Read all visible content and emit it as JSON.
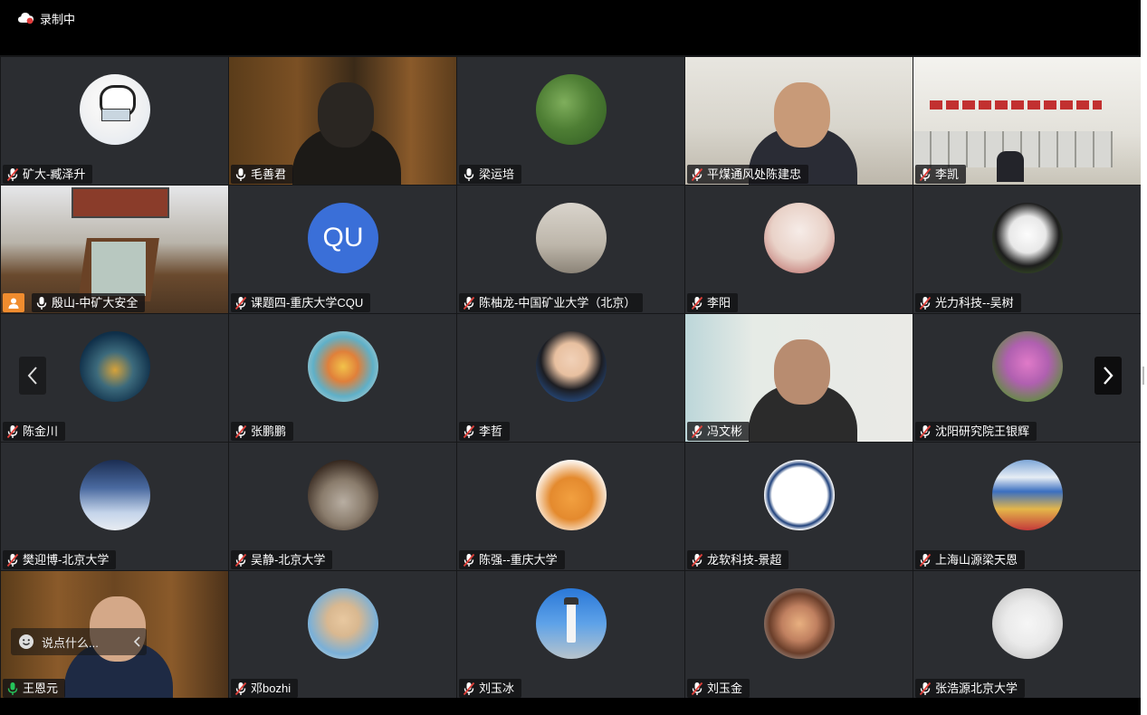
{
  "recording": {
    "label": "录制中"
  },
  "participants": [
    {
      "name": "矿大-臧泽升",
      "mic": "muted"
    },
    {
      "name": "毛善君",
      "mic": "on"
    },
    {
      "name": "梁运培",
      "mic": "on"
    },
    {
      "name": "平煤通风处陈建忠",
      "mic": "muted"
    },
    {
      "name": "李凯",
      "mic": "muted"
    },
    {
      "name": "殷山-中矿大安全",
      "mic": "on"
    },
    {
      "name": "课题四-重庆大学CQU",
      "mic": "muted",
      "avatar_text": "QU"
    },
    {
      "name": "陈柚龙-中国矿业大学（北京）",
      "mic": "muted"
    },
    {
      "name": "李阳",
      "mic": "muted"
    },
    {
      "name": "光力科技--吴树",
      "mic": "muted"
    },
    {
      "name": "陈金川",
      "mic": "muted"
    },
    {
      "name": "张鹏鹏",
      "mic": "muted"
    },
    {
      "name": "李哲",
      "mic": "muted"
    },
    {
      "name": "冯文彬",
      "mic": "muted"
    },
    {
      "name": "沈阳研究院王银辉",
      "mic": "muted"
    },
    {
      "name": "樊迎博-北京大学",
      "mic": "muted"
    },
    {
      "name": "吴静-北京大学",
      "mic": "muted"
    },
    {
      "name": "陈强--重庆大学",
      "mic": "muted"
    },
    {
      "name": "龙软科技-景超",
      "mic": "muted"
    },
    {
      "name": "上海山源梁天恩",
      "mic": "muted"
    },
    {
      "name": "王恩元",
      "mic": "speaking"
    },
    {
      "name": "邓bozhi",
      "mic": "muted"
    },
    {
      "name": "刘玉冰",
      "mic": "muted"
    },
    {
      "name": "刘玉金",
      "mic": "muted"
    },
    {
      "name": "张浩源北京大学",
      "mic": "muted"
    }
  ],
  "chat": {
    "placeholder": "说点什么..."
  },
  "colors": {
    "speaking_border": "#25c45a",
    "tile_bg": "#2b2d31",
    "muted_mic": "#e0403a"
  },
  "icons": {
    "prev": "chevron-left-icon",
    "next": "chevron-right-icon",
    "recording": "cloud-record-icon",
    "emoji": "smile-icon"
  }
}
